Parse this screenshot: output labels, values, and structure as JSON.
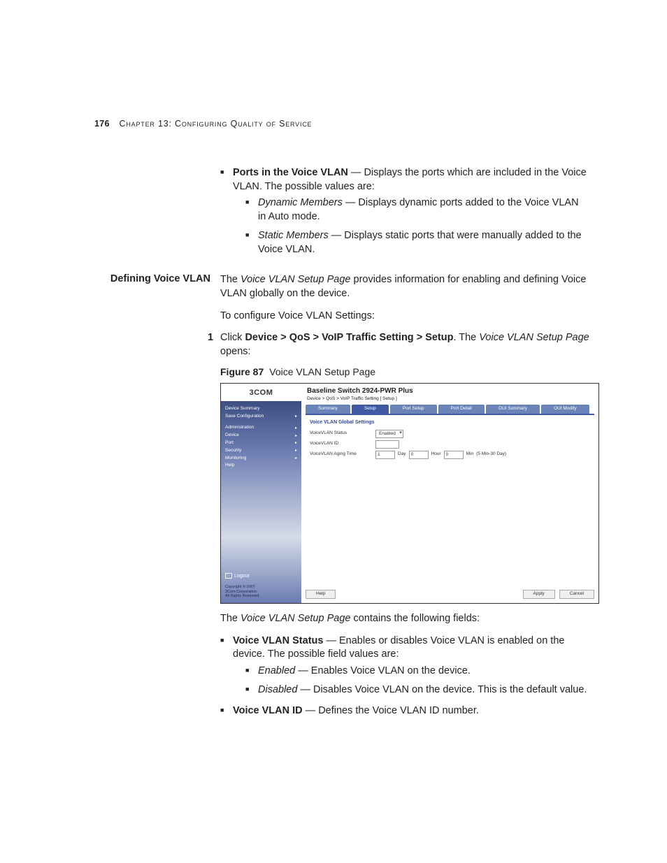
{
  "header": {
    "page_number": "176",
    "chapter_label": "Chapter 13: Configuring Quality of Service"
  },
  "body": {
    "ports_item": {
      "term": "Ports in the Voice VLAN",
      "desc": " — Displays the ports which are included in the Voice VLAN. The possible values are:",
      "sub": [
        {
          "term": "Dynamic Members",
          "desc": " — Displays dynamic ports added to the Voice VLAN in Auto mode."
        },
        {
          "term": "Static Members",
          "desc": " — Displays static ports that were manually added to the Voice VLAN."
        }
      ]
    },
    "section_heading": "Defining Voice VLAN",
    "intro_1a": "The ",
    "intro_1b": "Voice VLAN Setup Page",
    "intro_1c": " provides information for enabling and defining Voice VLAN globally on the device.",
    "intro_2": "To configure Voice VLAN Settings:",
    "step1": {
      "num": "1",
      "a": "Click ",
      "path": "Device > QoS > VoIP Traffic Setting > Setup",
      "b": ". The ",
      "page": "Voice VLAN Setup Page",
      "c": " opens:"
    },
    "figure": {
      "label": "Figure 87",
      "caption": "Voice VLAN Setup Page"
    },
    "after_fig_a": "The ",
    "after_fig_b": "Voice VLAN Setup Page",
    "after_fig_c": " contains the following fields:",
    "status_item": {
      "term": "Voice VLAN Status",
      "desc": " — Enables or disables Voice VLAN is enabled on the device. The possible field values are:",
      "sub": [
        {
          "term": "Enabled",
          "desc": " — Enables Voice VLAN on the device."
        },
        {
          "term": "Disabled",
          "desc": " — Disables Voice VLAN on the device. This is the default value."
        }
      ]
    },
    "vlanid_item": {
      "term": "Voice VLAN ID",
      "desc": " — Defines the Voice VLAN ID number."
    }
  },
  "shot": {
    "logo": "3COM",
    "title": "Baseline Switch 2924-PWR Plus",
    "crumb": "Device > QoS > VoIP Traffic Setting [ Setup ]",
    "side_top": [
      "Device Summary",
      "Save Configuration"
    ],
    "side_nav": [
      "Administration",
      "Device",
      "Port",
      "Security",
      "Monitoring",
      "Help"
    ],
    "logout": "Logout",
    "copyright": "Copyright © 2007\n3Com Corporation.\nAll Rights Reserved.",
    "tabs": [
      "Summary",
      "Setup",
      "Port Setup",
      "Port Detail",
      "OUI Summary",
      "OUI Modify"
    ],
    "panel_title": "Voice VLAN Global Settings",
    "f1_label": "VoiceVLAN Status",
    "f1_value": "Enabled",
    "f2_label": "VoiceVLAN ID",
    "f3_label": "VoiceVLAN Aging Time",
    "f3_day_val": "1",
    "f3_day_unit": "Day",
    "f3_hour_val": "0",
    "f3_hour_unit": "Hour",
    "f3_min_val": "0",
    "f3_min_unit": "Min",
    "f3_hint": "(5 Min-30 Day)",
    "btn_help": "Help",
    "btn_apply": "Apply",
    "btn_cancel": "Cancel"
  }
}
